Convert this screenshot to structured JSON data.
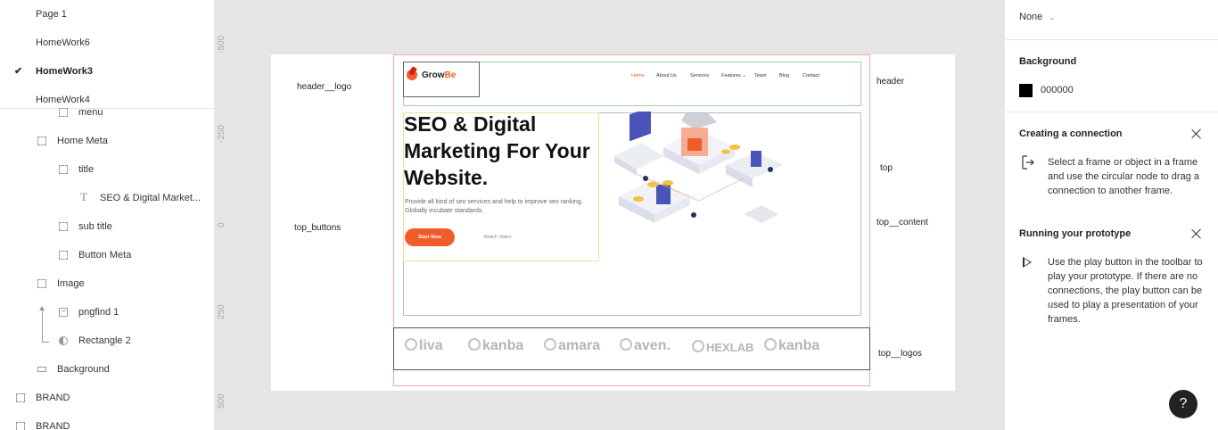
{
  "pages": [
    {
      "label": "Page 1",
      "active": false
    },
    {
      "label": "HomeWork6",
      "active": false
    },
    {
      "label": "HomeWork3",
      "active": true
    },
    {
      "label": "HomeWork4",
      "active": false
    }
  ],
  "layers": [
    {
      "label": "menu",
      "icon": "frame-icon"
    },
    {
      "label": "Home Meta",
      "icon": "frame-icon"
    },
    {
      "label": "title",
      "icon": "frame-icon"
    },
    {
      "label": "SEO & Digital Market...",
      "icon": "text-icon"
    },
    {
      "label": "sub title",
      "icon": "frame-icon"
    },
    {
      "label": "Button Meta",
      "icon": "frame-icon"
    },
    {
      "label": "Image",
      "icon": "frame-icon"
    },
    {
      "label": "pngfind 1",
      "icon": "image-icon"
    },
    {
      "label": "Rectangle 2",
      "icon": "mask-icon"
    },
    {
      "label": "Background",
      "icon": "rectangle-icon"
    },
    {
      "label": "BRAND",
      "icon": "frame-icon"
    },
    {
      "label": "BRAND",
      "icon": "frame-icon"
    }
  ],
  "ruler": [
    "-500",
    "-250",
    "0",
    "250",
    "500"
  ],
  "canvas": {
    "annotations": {
      "header_logo": "header__logo",
      "top_buttons": "top_buttons",
      "header": "header",
      "top": "top",
      "top_content": "top__content",
      "top_logos": "top__logos"
    },
    "site": {
      "logo_text": "Grow",
      "logo_accent": "Be",
      "nav": [
        "Home",
        "About Us",
        "Services",
        "Features ⌄",
        "Team",
        "Blog",
        "Contact"
      ],
      "hero_title": "SEO & Digital Marketing For Your Website.",
      "hero_subtitle": "Provide all kind of seo services and help to improve seo ranking. Globally incubate standards.",
      "start_button": "Start Now",
      "watch_button": "Watch Video",
      "brands": [
        "liva",
        "kanba",
        "amara",
        "aven.",
        "HEXLAB",
        "kanba"
      ]
    }
  },
  "inspector": {
    "dropdown_value": "None",
    "background_heading": "Background",
    "background_hex": "000000",
    "connection_heading": "Creating a connection",
    "connection_body": "Select a frame or object in a frame and use the circular node to drag a connection to another frame.",
    "prototype_heading": "Running your prototype",
    "prototype_body": "Use the play button in the toolbar to play your prototype. If there are no connections, the play button can be used to play a presentation of your frames.",
    "help_label": "?"
  },
  "colors": {
    "accent": "#f25c2a",
    "background_swatch": "#000000",
    "canvas": "#e5e5e5"
  }
}
